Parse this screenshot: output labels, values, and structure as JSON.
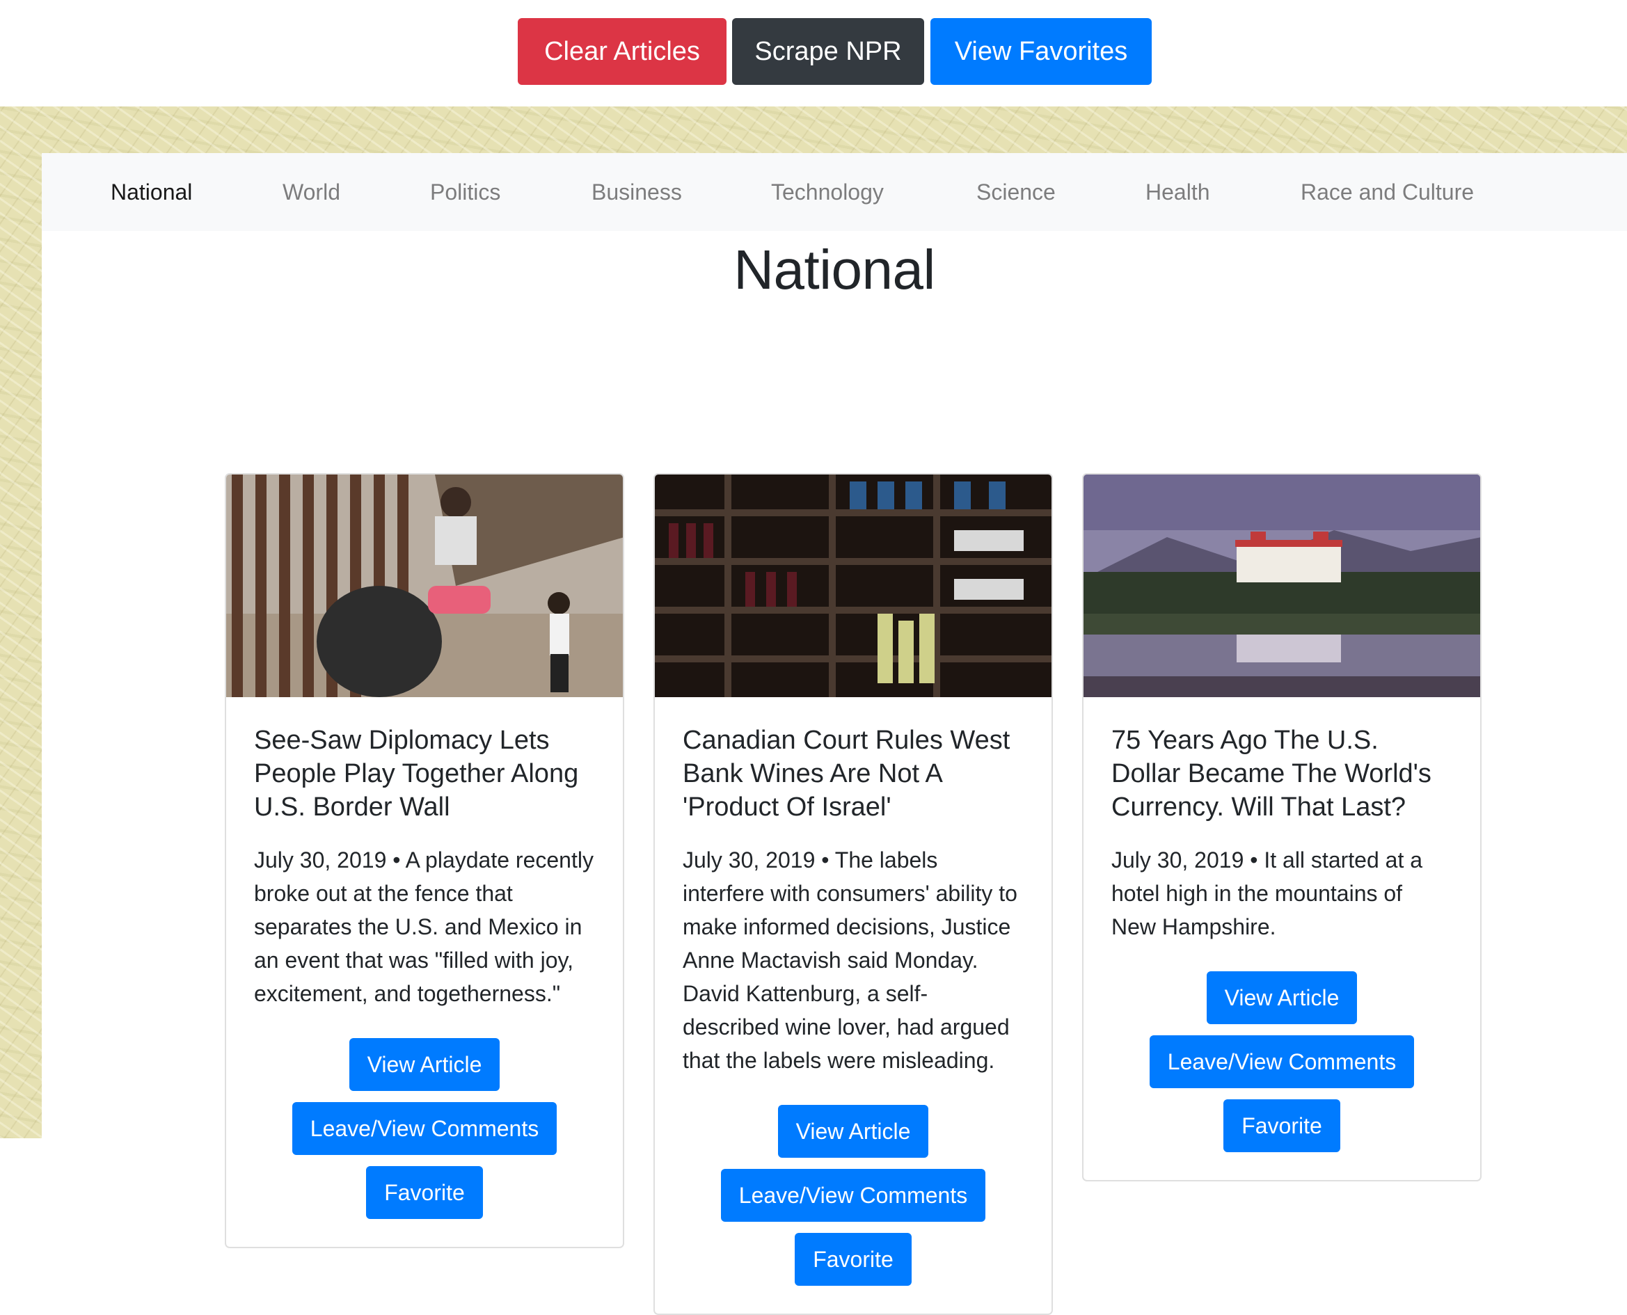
{
  "toolbar": {
    "clear_label": "Clear Articles",
    "scrape_label": "Scrape NPR",
    "favorites_label": "View Favorites"
  },
  "nav": {
    "items": [
      {
        "label": "National",
        "active": true
      },
      {
        "label": "World",
        "active": false
      },
      {
        "label": "Politics",
        "active": false
      },
      {
        "label": "Business",
        "active": false
      },
      {
        "label": "Technology",
        "active": false
      },
      {
        "label": "Science",
        "active": false
      },
      {
        "label": "Health",
        "active": false
      },
      {
        "label": "Race and Culture",
        "active": false
      }
    ]
  },
  "section": {
    "title": "National"
  },
  "articles": [
    {
      "title": "See-Saw Diplomacy Lets People Play Together Along U.S. Border Wall",
      "summary": "July 30, 2019 • A playdate recently broke out at the fence that separates the U.S. and Mexico in an event that was \"filled with joy, excitement, and togetherness.\"",
      "view_label": "View Article",
      "comments_label": "Leave/View Comments",
      "favorite_label": "Favorite"
    },
    {
      "title": "Canadian Court Rules West Bank Wines Are Not A 'Product Of Israel'",
      "summary": "July 30, 2019 • The labels interfere with consumers' ability to make informed decisions, Justice Anne Mactavish said Monday. David Kattenburg, a self-described wine lover, had argued that the labels were misleading.",
      "view_label": "View Article",
      "comments_label": "Leave/View Comments",
      "favorite_label": "Favorite"
    },
    {
      "title": "75 Years Ago The U.S. Dollar Became The World's Currency. Will That Last?",
      "summary": "July 30, 2019 • It all started at a hotel high in the mountains of New Hampshire.",
      "view_label": "View Article",
      "comments_label": "Leave/View Comments",
      "favorite_label": "Favorite"
    }
  ]
}
